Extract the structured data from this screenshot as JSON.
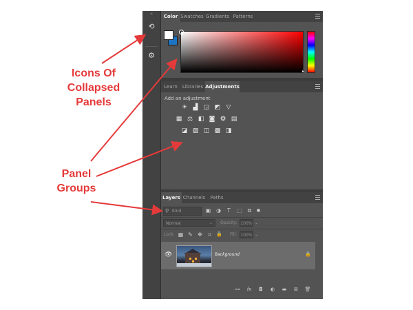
{
  "dock": {
    "collapse_glyph": "«",
    "expand_glyph": "»",
    "icons": [
      {
        "name": "history-panel-icon",
        "glyph": "⟲"
      },
      {
        "name": "properties-panel-icon",
        "glyph": "⚙"
      }
    ]
  },
  "color_panel": {
    "tabs": [
      "Color",
      "Swatches",
      "Gradients",
      "Patterns"
    ],
    "active_tab": "Color",
    "foreground_color": "#ffffff",
    "background_color": "#1f74c2",
    "picked_hue": "#ff0000"
  },
  "adjustments_panel": {
    "tabs": [
      "Learn",
      "Libraries",
      "Adjustments"
    ],
    "active_tab": "Adjustments",
    "title": "Add an adjustment",
    "rows": [
      [
        {
          "name": "brightness-contrast-icon",
          "glyph": "☀"
        },
        {
          "name": "levels-icon",
          "glyph": "▟"
        },
        {
          "name": "curves-icon",
          "glyph": "◲"
        },
        {
          "name": "exposure-icon",
          "glyph": "◩"
        },
        {
          "name": "vibrance-icon",
          "glyph": "▽"
        }
      ],
      [
        {
          "name": "hue-saturation-icon",
          "glyph": "▦"
        },
        {
          "name": "color-balance-icon",
          "glyph": "⚖"
        },
        {
          "name": "black-white-icon",
          "glyph": "◧"
        },
        {
          "name": "photo-filter-icon",
          "glyph": "◙"
        },
        {
          "name": "channel-mixer-icon",
          "glyph": "❂"
        },
        {
          "name": "color-lookup-icon",
          "glyph": "▤"
        }
      ],
      [
        {
          "name": "invert-icon",
          "glyph": "◪"
        },
        {
          "name": "posterize-icon",
          "glyph": "▨"
        },
        {
          "name": "threshold-icon",
          "glyph": "◫"
        },
        {
          "name": "gradient-map-icon",
          "glyph": "▩"
        },
        {
          "name": "selective-color-icon",
          "glyph": "◨"
        }
      ]
    ]
  },
  "layers_panel": {
    "tabs": [
      "Layers",
      "Channels",
      "Paths"
    ],
    "active_tab": "Layers",
    "search_icon": "⚲",
    "search_placeholder": "Kind",
    "filter_icons": [
      {
        "name": "pixel-filter-icon",
        "glyph": "▣"
      },
      {
        "name": "adjustment-filter-icon",
        "glyph": "◑"
      },
      {
        "name": "type-filter-icon",
        "glyph": "T"
      },
      {
        "name": "shape-filter-icon",
        "glyph": "⬚"
      },
      {
        "name": "smart-object-filter-icon",
        "glyph": "⧉"
      },
      {
        "name": "filter-toggle-icon",
        "glyph": "●"
      }
    ],
    "blend_mode": "Normal",
    "caret": "⌄",
    "opacity_label": "Opacity:",
    "opacity_value": "100%",
    "lock_label": "Lock:",
    "lock_icons": [
      {
        "name": "lock-transparent-icon",
        "glyph": "▦"
      },
      {
        "name": "lock-pixels-icon",
        "glyph": "✎"
      },
      {
        "name": "lock-position-icon",
        "glyph": "✥"
      },
      {
        "name": "lock-artboard-icon",
        "glyph": "⌗"
      },
      {
        "name": "lock-all-icon",
        "glyph": "🔒"
      }
    ],
    "fill_label": "Fill:",
    "fill_value": "100%",
    "layer": {
      "name": "Background",
      "visibility_glyph": "👁",
      "lock_glyph": "🔒"
    },
    "footer_icons": [
      {
        "name": "link-layers-icon",
        "glyph": "⊶"
      },
      {
        "name": "layer-style-icon",
        "glyph": "fx"
      },
      {
        "name": "add-mask-icon",
        "glyph": "◘"
      },
      {
        "name": "new-adjustment-layer-icon",
        "glyph": "◐"
      },
      {
        "name": "new-group-icon",
        "glyph": "▬"
      },
      {
        "name": "new-layer-icon",
        "glyph": "⊞"
      },
      {
        "name": "delete-layer-icon",
        "glyph": "🗑"
      }
    ]
  },
  "annotations": {
    "collapsed": [
      "Icons Of",
      "Collapsed",
      "Panels"
    ],
    "groups": [
      "Panel",
      "Groups"
    ],
    "color": "#e53a3a"
  }
}
